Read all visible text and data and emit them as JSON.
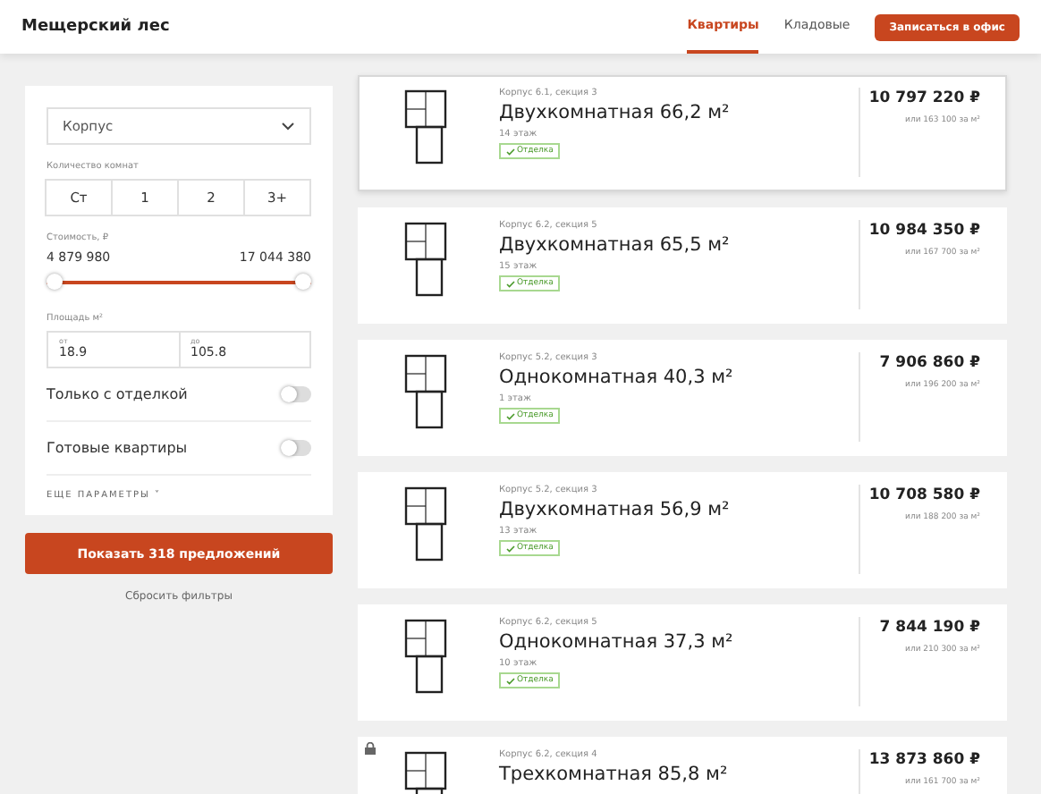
{
  "header": {
    "title": "Мещерский лес",
    "nav": [
      {
        "label": "Квартиры",
        "selected": true
      },
      {
        "label": "Кладовые",
        "selected": false
      }
    ],
    "cta": "Записаться в офис"
  },
  "filters": {
    "building": {
      "placeholder": "Корпус"
    },
    "rooms_label": "Количество комнат",
    "rooms": [
      {
        "label": "Ст",
        "selected": false
      },
      {
        "label": "1",
        "selected": false
      },
      {
        "label": "2",
        "selected": false
      },
      {
        "label": "3+",
        "selected": false
      }
    ],
    "price_label": "Стоимость, ₽",
    "price_min": "4 879 980",
    "price_max": "17 044 380",
    "price_thumbs": [
      {
        "level": 0
      },
      {
        "level": 1
      }
    ],
    "area_label": "Площадь м²",
    "area_from": {
      "label": "от",
      "value": "18.9"
    },
    "area_to": {
      "label": "до",
      "value": "105.8"
    },
    "toggles": [
      {
        "label": "Только с отделкой",
        "on": false
      },
      {
        "label": "Готовые квартиры",
        "on": false
      }
    ],
    "more": "ЕЩЕ ПАРАМЕТРЫ",
    "more_caret": "˅",
    "submit": "Показать 318 предложений",
    "reset": "Сбросить фильтры"
  },
  "listings": [
    {
      "building": "Корпус 6.1, секция 3",
      "title": "Двухкомнатная 66,2 м²",
      "floor": "14 этаж",
      "badge": "Отделка",
      "price": "10 797 220 ₽",
      "per_m2": "или 163 100 за м²",
      "selected": true,
      "locked": false
    },
    {
      "building": "Корпус 6.2, секция 5",
      "title": "Двухкомнатная 65,5 м²",
      "floor": "15 этаж",
      "badge": "Отделка",
      "price": "10 984 350 ₽",
      "per_m2": "или 167 700 за м²",
      "selected": false,
      "locked": false
    },
    {
      "building": "Корпус 5.2, секция 3",
      "title": "Однокомнатная 40,3 м²",
      "floor": "1 этаж",
      "badge": "Отделка",
      "price": "7 906 860 ₽",
      "per_m2": "или 196 200 за м²",
      "selected": false,
      "locked": false
    },
    {
      "building": "Корпус 5.2, секция 3",
      "title": "Двухкомнатная 56,9 м²",
      "floor": "13 этаж",
      "badge": "Отделка",
      "price": "10 708 580 ₽",
      "per_m2": "или 188 200 за м²",
      "selected": false,
      "locked": false
    },
    {
      "building": "Корпус 6.2, секция 5",
      "title": "Однокомнатная 37,3 м²",
      "floor": "10 этаж",
      "badge": "Отделка",
      "price": "7 844 190 ₽",
      "per_m2": "или 210 300 за м²",
      "selected": false,
      "locked": false
    },
    {
      "building": "Корпус 6.2, секция 4",
      "title": "Трехкомнатная 85,8 м²",
      "price": "13 873 860 ₽",
      "per_m2": "или 161 700 за м²",
      "selected": false,
      "locked": true
    }
  ]
}
